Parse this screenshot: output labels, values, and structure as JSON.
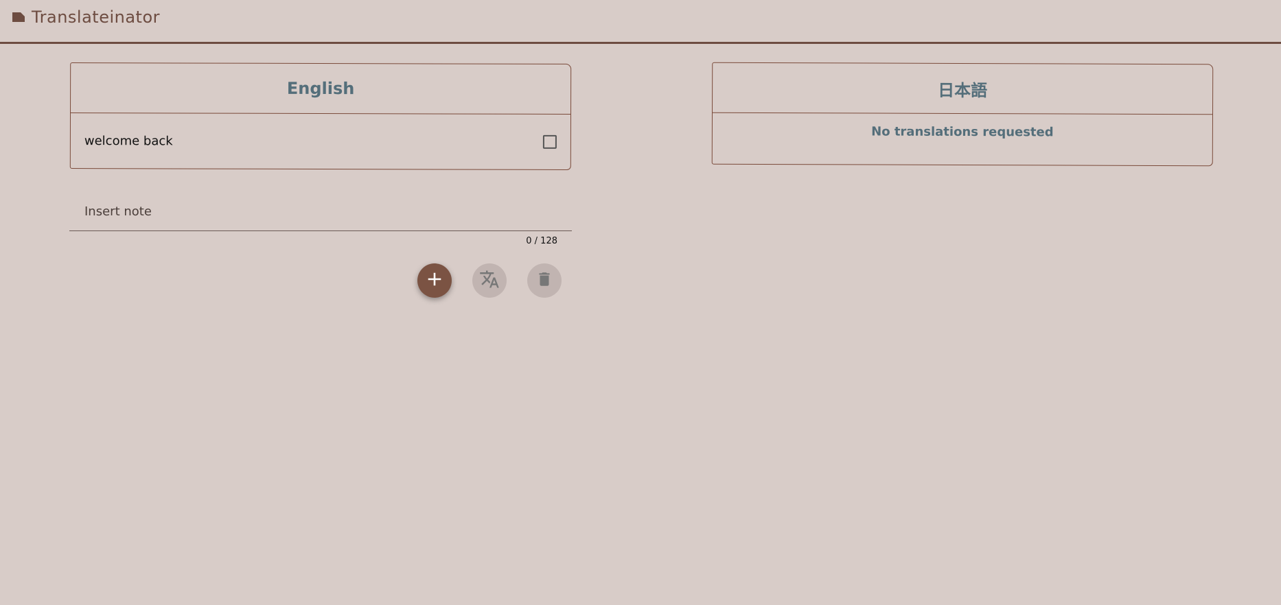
{
  "app": {
    "title": "Translateinator",
    "icon": "label-icon"
  },
  "source_panel": {
    "language": "English",
    "notes": [
      {
        "text": "welcome back",
        "checked": false
      }
    ]
  },
  "target_panel": {
    "language": "日本語",
    "empty_message": "No translations requested"
  },
  "note_input": {
    "placeholder": "Insert note",
    "value": "",
    "counter": "0 / 128"
  },
  "actions": {
    "add_icon": "plus-icon",
    "translate_icon": "translate-icon",
    "delete_icon": "trash-icon"
  },
  "colors": {
    "background": "#d8ccc8",
    "accent": "#6d4c41",
    "heading": "#546e7a",
    "disabled_button": "#c1b4b1"
  }
}
